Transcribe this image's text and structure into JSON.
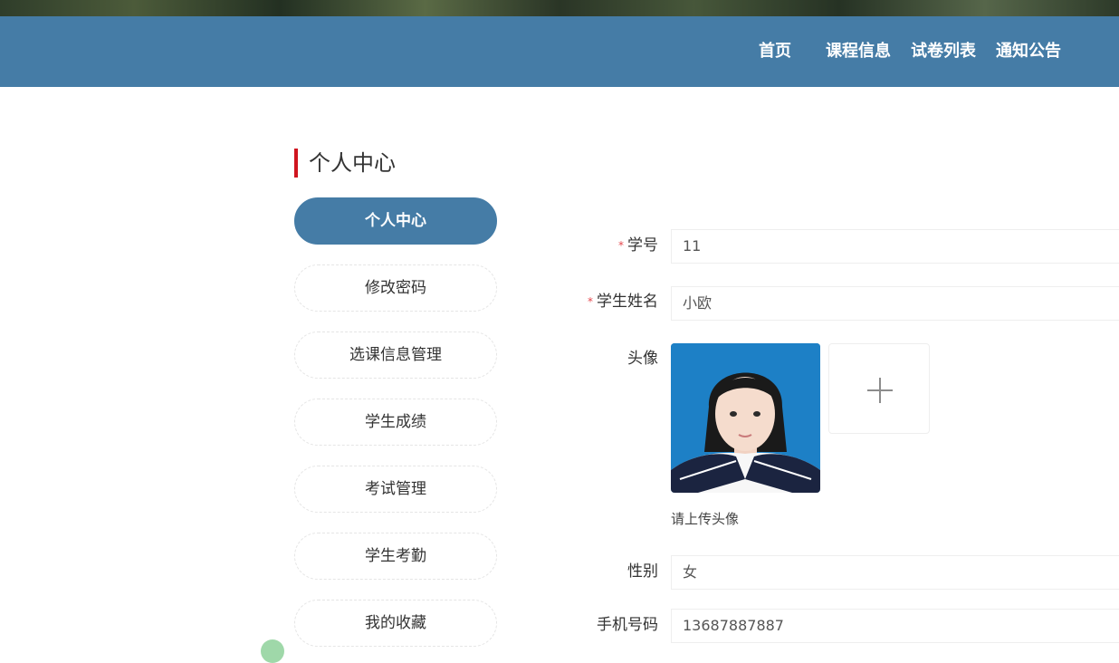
{
  "nav": {
    "items": [
      {
        "label": "首页"
      },
      {
        "label": "课程信息"
      },
      {
        "label": "试卷列表"
      },
      {
        "label": "通知公告"
      }
    ]
  },
  "page": {
    "heading": "个人中心",
    "accent_color": "#d0151f",
    "brand_color": "#457ca6"
  },
  "sidebar": {
    "items": [
      {
        "label": "个人中心",
        "active": true
      },
      {
        "label": "修改密码"
      },
      {
        "label": "选课信息管理"
      },
      {
        "label": "学生成绩"
      },
      {
        "label": "考试管理"
      },
      {
        "label": "学生考勤"
      },
      {
        "label": "我的收藏"
      }
    ]
  },
  "form": {
    "required_mark": "*",
    "student_id": {
      "label": "学号",
      "value": "11"
    },
    "student_name": {
      "label": "学生姓名",
      "value": "小欧"
    },
    "avatar": {
      "label": "头像",
      "hint": "请上传头像",
      "upload_icon": "plus-icon"
    },
    "gender": {
      "label": "性别",
      "value": "女"
    },
    "phone": {
      "label": "手机号码",
      "value": "13687887887"
    }
  }
}
